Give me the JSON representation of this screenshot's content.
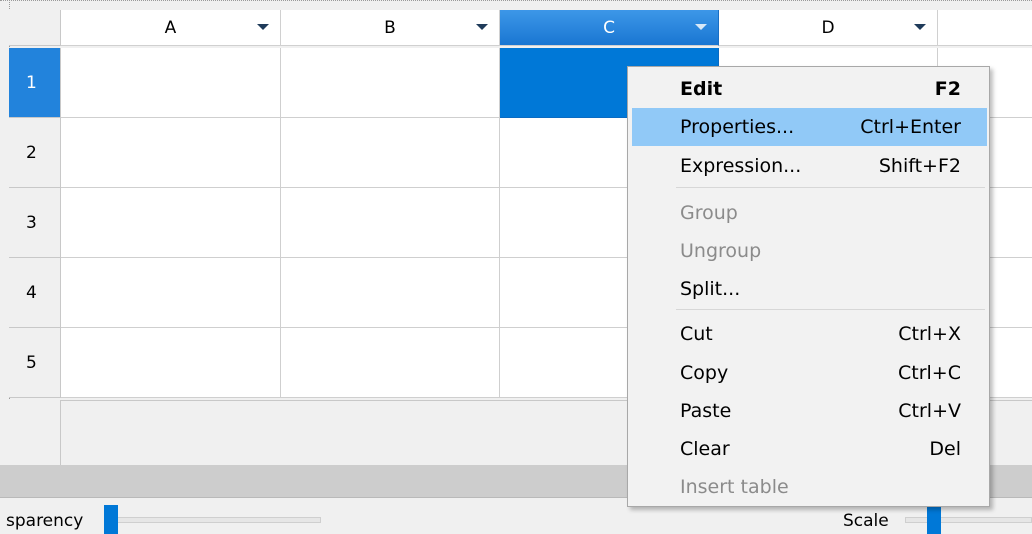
{
  "spreadsheet": {
    "columns": [
      "A",
      "B",
      "C",
      "D"
    ],
    "selected_column": "C",
    "rows": [
      "1",
      "2",
      "3",
      "4",
      "5"
    ],
    "selected_row": "1",
    "selected_cell": "C1"
  },
  "context_menu": {
    "items": [
      {
        "label": "Edit",
        "shortcut": "F2",
        "bold": true,
        "disabled": false
      },
      {
        "label": "Properties...",
        "shortcut": "Ctrl+Enter",
        "highlighted": true,
        "disabled": false
      },
      {
        "label": "Expression...",
        "shortcut": "Shift+F2",
        "disabled": false
      },
      {
        "label": "Group",
        "shortcut": "",
        "disabled": true
      },
      {
        "label": "Ungroup",
        "shortcut": "",
        "disabled": true
      },
      {
        "label": "Split...",
        "shortcut": "",
        "disabled": false
      },
      {
        "label": "Cut",
        "shortcut": "Ctrl+X",
        "disabled": false
      },
      {
        "label": "Copy",
        "shortcut": "Ctrl+C",
        "disabled": false
      },
      {
        "label": "Paste",
        "shortcut": "Ctrl+V",
        "disabled": false
      },
      {
        "label": "Clear",
        "shortcut": "Del",
        "disabled": false
      },
      {
        "label": "Insert table",
        "shortcut": "",
        "disabled": true
      }
    ]
  },
  "bottom_bar": {
    "transparency_label": "sparency",
    "scale_label": "Scale"
  },
  "colors": {
    "selection": "#0078d7",
    "menu_hover": "#91c9f7"
  }
}
